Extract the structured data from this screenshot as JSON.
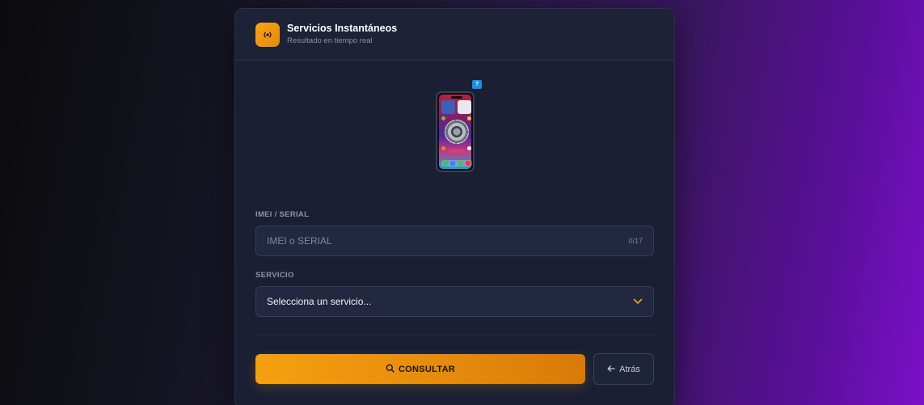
{
  "header": {
    "title": "Servicios Instantáneos",
    "subtitle": "Resultado en tiempo real",
    "icon": "broadcast-icon"
  },
  "device": {
    "badge": "?"
  },
  "imei": {
    "label": "IMEI / SERIAL",
    "placeholder": "IMEI o SERIAL",
    "value": "",
    "counter": "0/17"
  },
  "service": {
    "label": "SERVICIO",
    "selected": "Selecciona un servicio..."
  },
  "actions": {
    "consult_label": "CONSULTAR",
    "back_label": "Atrás"
  },
  "colors": {
    "accent": "#f5a00f",
    "card_bg": "#1a1f33",
    "input_bg": "#222840"
  }
}
